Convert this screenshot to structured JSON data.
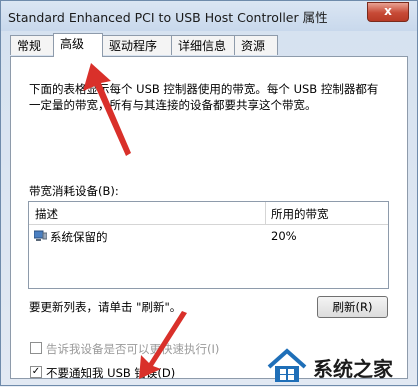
{
  "window": {
    "title": "Standard Enhanced PCI to USB Host Controller 属性",
    "close_label": "x"
  },
  "tabs": [
    {
      "label": "常规"
    },
    {
      "label": "高级"
    },
    {
      "label": "驱动程序"
    },
    {
      "label": "详细信息"
    },
    {
      "label": "资源"
    }
  ],
  "description": "下面的表格显示每个 USB 控制器使用的带宽。每个 USB 控制器都有一定量的带宽，所有与其连接的设备都要共享这个带宽。",
  "bandwidth_label": "带宽消耗设备(B):",
  "list": {
    "headers": [
      "描述",
      "所用的带宽"
    ],
    "rows": [
      {
        "device": "系统保留的",
        "bandwidth": "20%"
      }
    ]
  },
  "refresh_hint": "要更新列表，请单击 \"刷新\"。",
  "refresh_button": "刷新(R)",
  "options": [
    {
      "label": "告诉我设备是否可以更快速执行(I)",
      "checked": false,
      "disabled": true
    },
    {
      "label": "不要通知我 USB 错误(D)",
      "checked": true,
      "disabled": false
    }
  ],
  "watermark": {
    "text": "系统之家"
  },
  "colors": {
    "annotation_arrow": "#d9302a",
    "accent": "#1f6fb8"
  }
}
